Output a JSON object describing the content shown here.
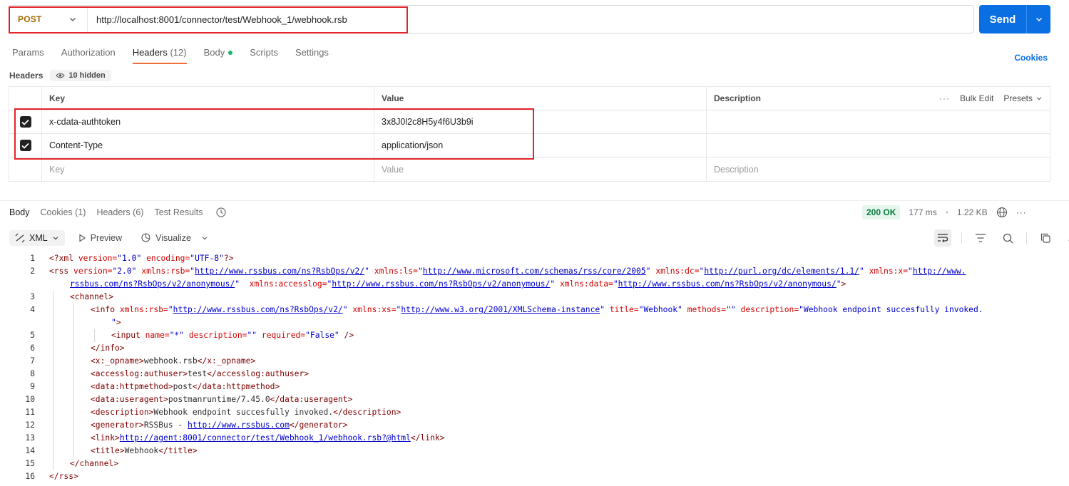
{
  "request": {
    "method": "POST",
    "url": "http://localhost:8001/connector/test/Webhook_1/webhook.rsb",
    "send_label": "Send"
  },
  "request_tabs": [
    {
      "label": "Params"
    },
    {
      "label": "Authorization"
    },
    {
      "label": "Headers",
      "count": "(12)"
    },
    {
      "label": "Body"
    },
    {
      "label": "Scripts"
    },
    {
      "label": "Settings"
    }
  ],
  "cookies_link": "Cookies",
  "headers_section": {
    "title": "Headers",
    "hidden": "10 hidden",
    "columns": {
      "key": "Key",
      "value": "Value",
      "description": "Description"
    },
    "bulk_edit": "Bulk Edit",
    "presets": "Presets",
    "rows": [
      {
        "key": "x-cdata-authtoken",
        "value": "3x8J0l2c8H5y4f6U3b9i",
        "description": "",
        "checked": true
      },
      {
        "key": "Content-Type",
        "value": "application/json",
        "description": "",
        "checked": true
      }
    ],
    "placeholders": {
      "key": "Key",
      "value": "Value",
      "description": "Description"
    }
  },
  "response": {
    "tabs": [
      {
        "label": "Body"
      },
      {
        "label": "Cookies",
        "count": "(1)"
      },
      {
        "label": "Headers",
        "count": "(6)"
      },
      {
        "label": "Test Results"
      }
    ],
    "status": "200 OK",
    "time": "177 ms",
    "size": "1.22 KB",
    "format": "XML",
    "preview": "Preview",
    "visualize": "Visualize"
  },
  "code_lines": [
    {
      "n": "1",
      "indent": 0,
      "parts": [
        [
          "tag",
          "<?xml "
        ],
        [
          "attr",
          "version="
        ],
        [
          "val",
          "\"1.0\""
        ],
        [
          "txt",
          " "
        ],
        [
          "attr",
          "encoding="
        ],
        [
          "val",
          "\"UTF-8\""
        ],
        [
          "tag",
          "?>"
        ]
      ]
    },
    {
      "n": "2",
      "indent": 0,
      "parts": [
        [
          "tag",
          "<rss "
        ],
        [
          "attr",
          "version="
        ],
        [
          "val",
          "\"2.0\""
        ],
        [
          "txt",
          " "
        ],
        [
          "attr",
          "xmlns:rsb="
        ],
        [
          "val",
          "\""
        ],
        [
          "lnk",
          "http://www.rssbus.com/ns?RsbOps/v2/"
        ],
        [
          "val",
          "\""
        ],
        [
          "txt",
          " "
        ],
        [
          "attr",
          "xmlns:ls="
        ],
        [
          "val",
          "\""
        ],
        [
          "lnk",
          "http://www.microsoft.com/schemas/rss/core/2005"
        ],
        [
          "val",
          "\""
        ],
        [
          "txt",
          " "
        ],
        [
          "attr",
          "xmlns:dc="
        ],
        [
          "val",
          "\""
        ],
        [
          "lnk",
          "http://purl.org/dc/elements/1.1/"
        ],
        [
          "val",
          "\""
        ],
        [
          "txt",
          " "
        ],
        [
          "attr",
          "xmlns:x="
        ],
        [
          "val",
          "\""
        ],
        [
          "lnk",
          "http://www."
        ]
      ]
    },
    {
      "n": "",
      "indent": 0,
      "wrap": true,
      "parts": [
        [
          "lnk",
          "rssbus.com/ns?RsbOps/v2/anonymous/"
        ],
        [
          "val",
          "\""
        ],
        [
          "txt",
          "  "
        ],
        [
          "attr",
          "xmlns:accesslog="
        ],
        [
          "val",
          "\""
        ],
        [
          "lnk",
          "http://www.rssbus.com/ns?RsbOps/v2/anonymous/"
        ],
        [
          "val",
          "\""
        ],
        [
          "txt",
          " "
        ],
        [
          "attr",
          "xmlns:data="
        ],
        [
          "val",
          "\""
        ],
        [
          "lnk",
          "http://www.rssbus.com/ns?RsbOps/v2/anonymous/"
        ],
        [
          "val",
          "\""
        ],
        [
          "tag",
          ">"
        ]
      ]
    },
    {
      "n": "3",
      "indent": 1,
      "parts": [
        [
          "tag",
          "<channel>"
        ]
      ]
    },
    {
      "n": "4",
      "indent": 2,
      "parts": [
        [
          "tag",
          "<info "
        ],
        [
          "attr",
          "xmlns:rsb="
        ],
        [
          "val",
          "\""
        ],
        [
          "lnk",
          "http://www.rssbus.com/ns?RsbOps/v2/"
        ],
        [
          "val",
          "\""
        ],
        [
          "txt",
          " "
        ],
        [
          "attr",
          "xmlns:xs="
        ],
        [
          "val",
          "\""
        ],
        [
          "lnk",
          "http://www.w3.org/2001/XMLSchema-instance"
        ],
        [
          "val",
          "\""
        ],
        [
          "txt",
          " "
        ],
        [
          "attr",
          "title="
        ],
        [
          "val",
          "\"Webhook\""
        ],
        [
          "txt",
          " "
        ],
        [
          "attr",
          "methods="
        ],
        [
          "val",
          "\"\""
        ],
        [
          "txt",
          " "
        ],
        [
          "attr",
          "description="
        ],
        [
          "val",
          "\"Webhook endpoint succesfully invoked."
        ]
      ]
    },
    {
      "n": "",
      "indent": 2,
      "wrap": true,
      "parts": [
        [
          "val",
          "\""
        ],
        [
          "tag",
          ">"
        ]
      ]
    },
    {
      "n": "5",
      "indent": 3,
      "parts": [
        [
          "tag",
          "<input "
        ],
        [
          "attr",
          "name="
        ],
        [
          "val",
          "\"*\""
        ],
        [
          "txt",
          " "
        ],
        [
          "attr",
          "description="
        ],
        [
          "val",
          "\"\""
        ],
        [
          "txt",
          " "
        ],
        [
          "attr",
          "required="
        ],
        [
          "val",
          "\"False\""
        ],
        [
          "tag",
          " />"
        ]
      ]
    },
    {
      "n": "6",
      "indent": 2,
      "parts": [
        [
          "tag",
          "</info>"
        ]
      ]
    },
    {
      "n": "7",
      "indent": 2,
      "parts": [
        [
          "tag",
          "<x:_opname>"
        ],
        [
          "txt",
          "webhook.rsb"
        ],
        [
          "tag",
          "</x:_opname>"
        ]
      ]
    },
    {
      "n": "8",
      "indent": 2,
      "parts": [
        [
          "tag",
          "<accesslog:authuser>"
        ],
        [
          "txt",
          "test"
        ],
        [
          "tag",
          "</accesslog:authuser>"
        ]
      ]
    },
    {
      "n": "9",
      "indent": 2,
      "parts": [
        [
          "tag",
          "<data:httpmethod>"
        ],
        [
          "txt",
          "post"
        ],
        [
          "tag",
          "</data:httpmethod>"
        ]
      ]
    },
    {
      "n": "10",
      "indent": 2,
      "parts": [
        [
          "tag",
          "<data:useragent>"
        ],
        [
          "txt",
          "postmanruntime/7.45.0"
        ],
        [
          "tag",
          "</data:useragent>"
        ]
      ]
    },
    {
      "n": "11",
      "indent": 2,
      "parts": [
        [
          "tag",
          "<description>"
        ],
        [
          "txt",
          "Webhook endpoint succesfully invoked."
        ],
        [
          "tag",
          "</description>"
        ]
      ]
    },
    {
      "n": "12",
      "indent": 2,
      "parts": [
        [
          "tag",
          "<generator>"
        ],
        [
          "txt",
          "RSSBus - "
        ],
        [
          "lnk",
          "http://www.rssbus.com"
        ],
        [
          "tag",
          "</generator>"
        ]
      ]
    },
    {
      "n": "13",
      "indent": 2,
      "parts": [
        [
          "tag",
          "<link>"
        ],
        [
          "lnk",
          "http://agent:8001/connector/test/Webhook_1/webhook.rsb?@html"
        ],
        [
          "tag",
          "</link>"
        ]
      ]
    },
    {
      "n": "14",
      "indent": 2,
      "parts": [
        [
          "tag",
          "<title>"
        ],
        [
          "txt",
          "Webhook"
        ],
        [
          "tag",
          "</title>"
        ]
      ]
    },
    {
      "n": "15",
      "indent": 1,
      "parts": [
        [
          "tag",
          "</channel>"
        ]
      ]
    },
    {
      "n": "16",
      "indent": 0,
      "parts": [
        [
          "tag",
          "</rss>"
        ]
      ]
    }
  ],
  "colors": {
    "accent": "#0a6fe3",
    "highlight": "#e2242a",
    "method": "#a66a00",
    "tab_active": "#f26b3a"
  }
}
